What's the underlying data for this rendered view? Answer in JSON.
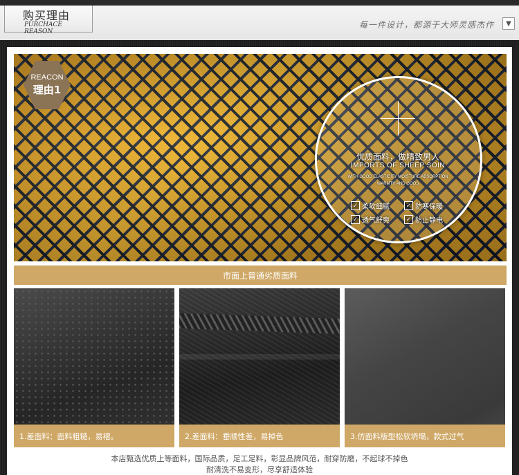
{
  "header": {
    "title_cn": "购买理由",
    "title_en": "PURCHACE REASON",
    "slogan": "每一件设计，都源于大师灵感杰作"
  },
  "badge": {
    "en": "REACON",
    "cn": "理由1"
  },
  "circle": {
    "title": "优质面料，做精致男人",
    "subtitle_en": "IMPORTS OF SHEEP SOIN",
    "line1": "WITH GOOD ELASTICITY MOISTURE ABSORPTION",
    "line2": "WARMTH AND GOOS",
    "features": [
      "柔软细腻",
      "防寒保暖",
      "透气舒爽",
      "防止静电"
    ]
  },
  "banner": {
    "text": "市面上普通劣质面料"
  },
  "samples": [
    {
      "caption": "1.差面料：面料粗糙，易褶。"
    },
    {
      "caption": "2.差面料：垂顺性差，易掉色"
    },
    {
      "caption": "3.仿面料版型松软坍塌，款式过气"
    }
  ],
  "footer": {
    "line1": "本店甄选优质上等面料，国际品质，足工足料，彰显品牌风范，耐穿防磨，不起球不掉色",
    "line2": "耐清洗不易变形，尽享舒适体验"
  },
  "colors": {
    "accent": "#cfa867",
    "badge": "#8b7355",
    "dark": "#1e1e1e"
  }
}
